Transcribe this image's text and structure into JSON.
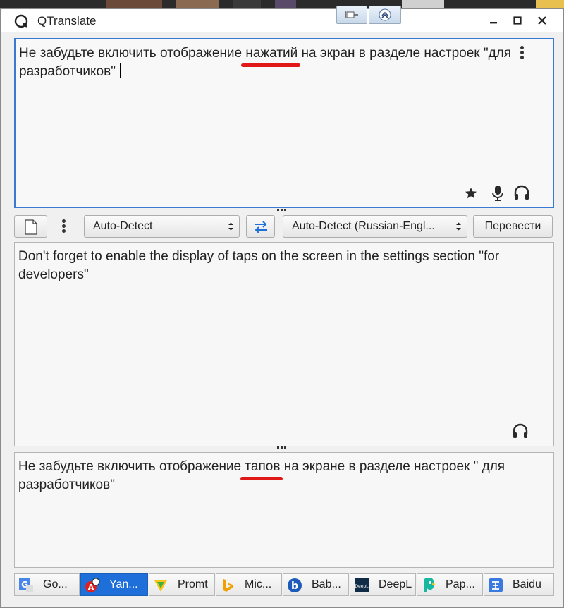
{
  "window": {
    "title": "QTranslate"
  },
  "source": {
    "text_before": "Не забудьте включить отображение ",
    "text_marked": "нажатий",
    "text_after": " на экран в разделе настроек \"для разработчиков\""
  },
  "toolbar": {
    "source_language": "Auto-Detect",
    "target_language": "Auto-Detect (Russian-Engl...",
    "translate_label": "Перевести"
  },
  "result": {
    "text": "Don't forget to enable the display of taps on the screen in the settings section \"for developers\""
  },
  "back_translation": {
    "text_before": "Не забудьте включить отображение ",
    "text_marked": "тапов",
    "text_after": " на экране в разделе настроек \" для разработчиков\""
  },
  "services": [
    {
      "label": "Go...",
      "icon": "google-icon"
    },
    {
      "label": "Yan...",
      "icon": "yandex-icon"
    },
    {
      "label": "Promt",
      "icon": "promt-icon"
    },
    {
      "label": "Mic...",
      "icon": "bing-icon"
    },
    {
      "label": "Bab...",
      "icon": "babylon-icon"
    },
    {
      "label": "DeepL",
      "icon": "deepl-icon"
    },
    {
      "label": "Pap...",
      "icon": "papago-icon"
    },
    {
      "label": "Baidu",
      "icon": "baidu-icon"
    }
  ],
  "colors": {
    "accent": "#1e6fd9",
    "highlight": "#e01818",
    "focus_border": "#3a78d6"
  }
}
